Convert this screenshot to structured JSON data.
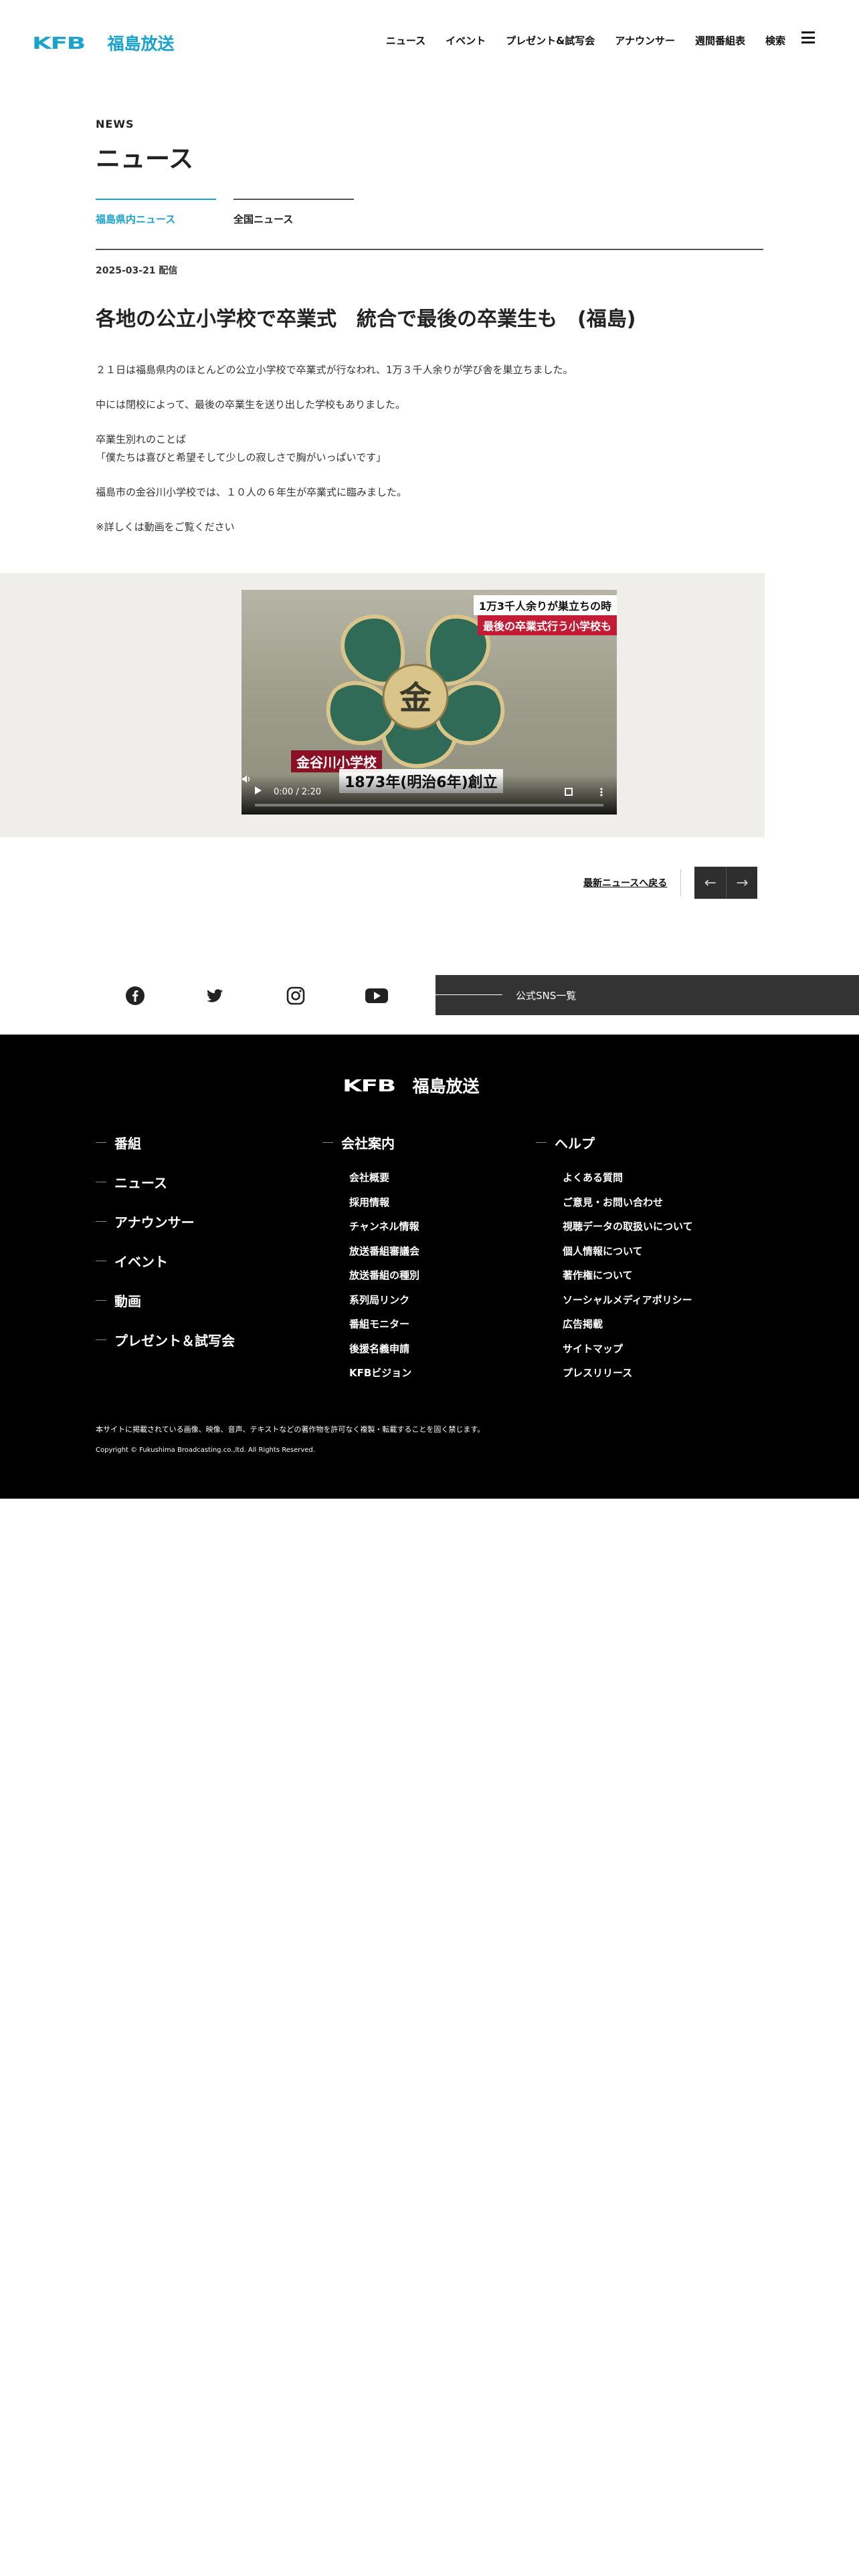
{
  "header": {
    "logo_mark": "KFB",
    "logo_name": "福島放送",
    "nav": [
      "ニュース",
      "イベント",
      "プレゼント&試写会",
      "アナウンサー",
      "週間番組表",
      "検索"
    ]
  },
  "main": {
    "eyebrow": "NEWS",
    "title": "ニュース",
    "tabs": [
      {
        "label": "福島県内ニュース",
        "active": true
      },
      {
        "label": "全国ニュース",
        "active": false
      }
    ],
    "date": "2025-03-21 配信",
    "headline": "各地の公立小学校で卒業式　統合で最後の卒業生も　(福島)",
    "paragraphs": [
      "２１日は福島県内のほとんどの公立小学校で卒業式が行なわれ、1万３千人余りが学び舎を巣立ちました。",
      "中には閉校によって、最後の卒業生を送り出した学校もありました。",
      "卒業生別れのことば\n「僕たちは喜びと希望そして少しの寂しさで胸がいっぱいです」",
      "福島市の金谷川小学校では、１０人の６年生が卒業式に臨みました。",
      "※詳しくは動画をご覧ください"
    ]
  },
  "video": {
    "caption_top": "1万3千人余りが巣立ちの時",
    "caption_bottom": "最後の卒業式行う小学校も",
    "school_label": "金谷川小学校",
    "founded_label": "1873年(明治6年)創立",
    "time": "0:00 / 2:20",
    "progress": 0
  },
  "pager": {
    "back_label": "最新ニュースへ戻る",
    "prev_icon": "arrow-left-icon",
    "next_icon": "arrow-right-icon"
  },
  "sns": {
    "icons": [
      "facebook-icon",
      "twitter-icon",
      "instagram-icon",
      "youtube-icon"
    ],
    "bar_label": "公式SNS一覧"
  },
  "footer": {
    "logo_mark": "KFB",
    "logo_name": "福島放送",
    "col1": [
      "番組",
      "ニュース",
      "アナウンサー",
      "イベント",
      "動画",
      "プレゼント＆試写会"
    ],
    "col2_head": "会社案内",
    "col2": [
      "会社概要",
      "採用情報",
      "チャンネル情報",
      "放送番組審議会",
      "放送番組の種別",
      "系列局リンク",
      "番組モニター",
      "後援名義申請",
      "KFBビジョン"
    ],
    "col3_head": "ヘルプ",
    "col3": [
      "よくある質問",
      "ご意見・お問い合わせ",
      "視聴データの取扱いについて",
      "個人情報について",
      "著作権について",
      "ソーシャルメディアポリシー",
      "広告掲載",
      "サイトマップ",
      "プレスリリース"
    ],
    "legal": "本サイトに掲載されている画像、映像、音声、テキストなどの著作物を許可なく複製・転載することを固く禁じます。",
    "copyright": "Copyright © Fukushima Broadcasting.co.,ltd. All Rights Reserved."
  },
  "colors": {
    "accent": "#1aa3cc",
    "footer_bg": "#000000",
    "band_bg": "#f0eeea"
  }
}
